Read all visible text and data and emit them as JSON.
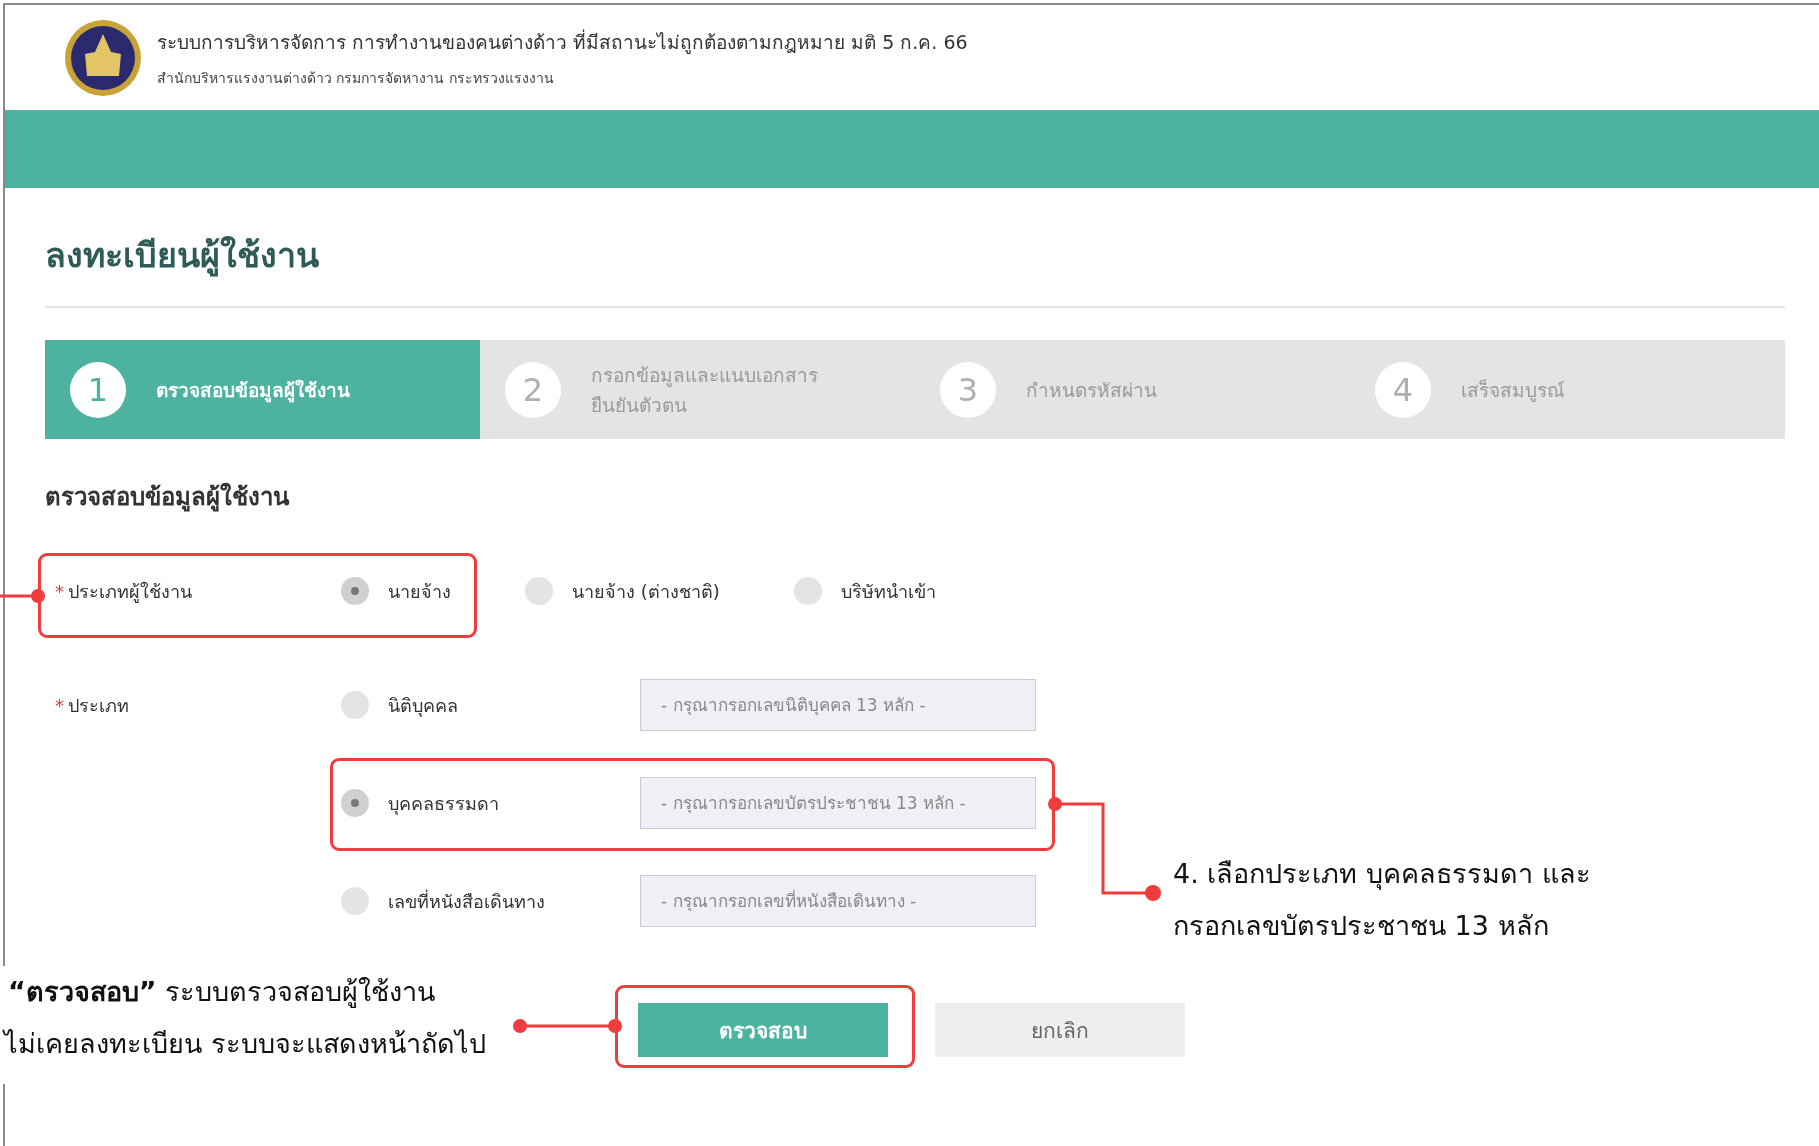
{
  "header": {
    "title": "ระบบการบริหารจัดการ การทำงานของคนต่างด้าว  ที่มีสถานะไม่ถูกต้องตามกฎหมาย มติ 5 ก.ค. 66",
    "subtitle": "สำนักบริหารแรงงานต่างด้าว  กรมการจัดหางาน  กระทรวงแรงงาน"
  },
  "page_title": "ลงทะเบียนผู้ใช้งาน",
  "steps": [
    {
      "number": "1",
      "label": "ตรวจสอบข้อมูลผู้ใช้งาน",
      "selected": true
    },
    {
      "number": "2",
      "label": "กรอกข้อมูลและแนบเอกสาร ยืนยันตัวตน",
      "selected": false
    },
    {
      "number": "3",
      "label": "กำหนดรหัสผ่าน",
      "selected": false
    },
    {
      "number": "4",
      "label": "เสร็จสมบูรณ์",
      "selected": false
    }
  ],
  "section_title": "ตรวจสอบข้อมูลผู้ใช้งาน",
  "user_type": {
    "required_mark": "*",
    "label": "ประเภทผู้ใช้งาน",
    "options": [
      {
        "label": "นายจ้าง",
        "selected": true
      },
      {
        "label": "นายจ้าง (ต่างชาติ)",
        "selected": false
      },
      {
        "label": "บริษัทนำเข้า",
        "selected": false
      }
    ]
  },
  "id_type": {
    "required_mark": "*",
    "label": "ประเภท",
    "options": [
      {
        "label": "นิติบุคคล",
        "selected": false,
        "placeholder": "- กรุณากรอกเลขนิติบุคคล 13 หลัก -"
      },
      {
        "label": "บุคคลธรรมดา",
        "selected": true,
        "placeholder": "- กรุณากรอกเลขบัตรประชาชน 13 หลัก -"
      },
      {
        "label": "เลขที่หนังสือเดินทาง",
        "selected": false,
        "placeholder": "- กรุณากรอกเลขที่หนังสือเดินทาง -"
      }
    ]
  },
  "buttons": [
    {
      "label": "ตรวจสอบ",
      "kind": "primary"
    },
    {
      "label": "ยกเลิก",
      "kind": "secondary"
    }
  ],
  "annotations": {
    "step_note": [
      "4. เลือกประเภท บุคคลธรรมดา และ",
      "กรอกเลขบัตรประชาชน 13 หลัก"
    ],
    "check_note": [
      "**“ตรวจสอบ”**  ระบบตรวจสอบผู้ใช้งาน",
      "ไม่เคยลงทะเบียน ระบบจะแสดงหน้าถัดไป"
    ]
  }
}
